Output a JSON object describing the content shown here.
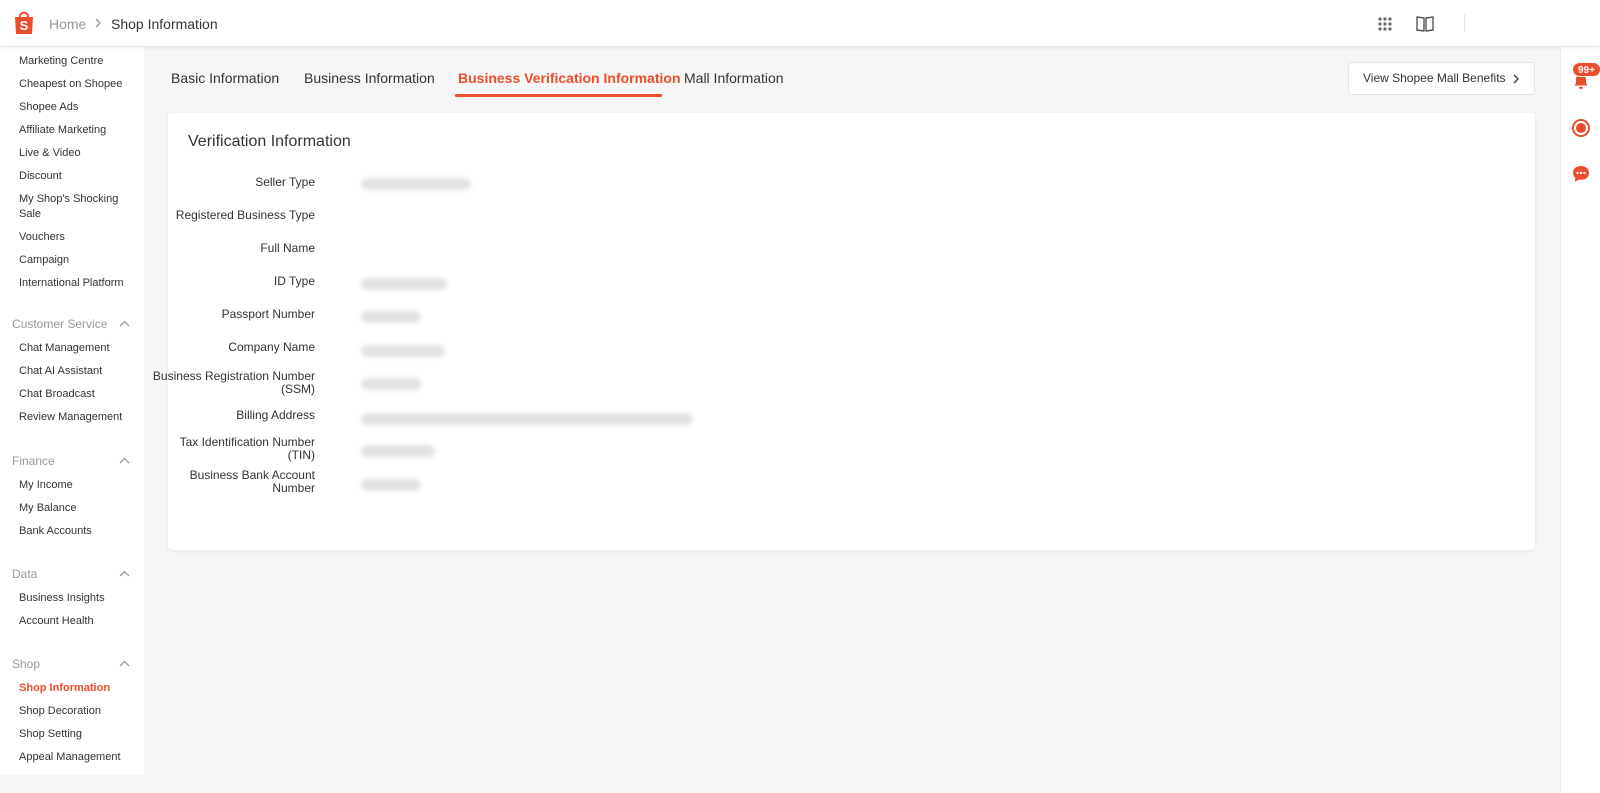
{
  "breadcrumb": {
    "home": "Home",
    "current": "Shop Information"
  },
  "colors": {
    "accent": "#ee4d2d",
    "text": "#333333",
    "muted": "#999999"
  },
  "topbar_icons": [
    "shopee-logo-icon",
    "apps-grid-icon",
    "book-icon"
  ],
  "sidebar": {
    "marketing": [
      "Marketing Centre",
      "Cheapest on Shopee",
      "Shopee Ads",
      "Affiliate Marketing",
      "Live & Video",
      "Discount",
      "My Shop's Shocking Sale",
      "Vouchers",
      "Campaign",
      "International Platform"
    ],
    "customer_service": {
      "title": "Customer Service",
      "items": [
        "Chat Management",
        "Chat AI Assistant",
        "Chat Broadcast",
        "Review Management"
      ]
    },
    "finance": {
      "title": "Finance",
      "items": [
        "My Income",
        "My Balance",
        "Bank Accounts"
      ]
    },
    "data": {
      "title": "Data",
      "items": [
        "Business Insights",
        "Account Health"
      ]
    },
    "shop": {
      "title": "Shop",
      "items": [
        "Shop Information",
        "Shop Decoration",
        "Shop Setting",
        "Appeal Management"
      ],
      "active": "Shop Information"
    }
  },
  "tabs": [
    "Basic Information",
    "Business Information",
    "Business Verification Information",
    "Mall Information"
  ],
  "active_tab": "Business Verification Information",
  "mall_button": "View Shopee Mall Benefits",
  "card": {
    "title": "Verification Information",
    "fields": [
      {
        "label": "Seller Type",
        "value_blurred": true
      },
      {
        "label": "Registered Business Type",
        "value_blurred": false
      },
      {
        "label": "Full Name",
        "value_blurred": false
      },
      {
        "label": "ID Type",
        "value_blurred": true
      },
      {
        "label": "Passport Number",
        "value_blurred": true
      },
      {
        "label": "Company Name",
        "value_blurred": true
      },
      {
        "label_line1": "Business Registration Number",
        "label_line2": "(SSM)",
        "value_blurred": true
      },
      {
        "label": "Billing Address",
        "value_blurred": true
      },
      {
        "label_line1": "Tax Identification Number",
        "label_line2": "(TIN)",
        "value_blurred": true
      },
      {
        "label_line1": "Business Bank Account",
        "label_line2": "Number",
        "value_blurred": true
      }
    ]
  },
  "notifications": {
    "badge": "99+"
  }
}
